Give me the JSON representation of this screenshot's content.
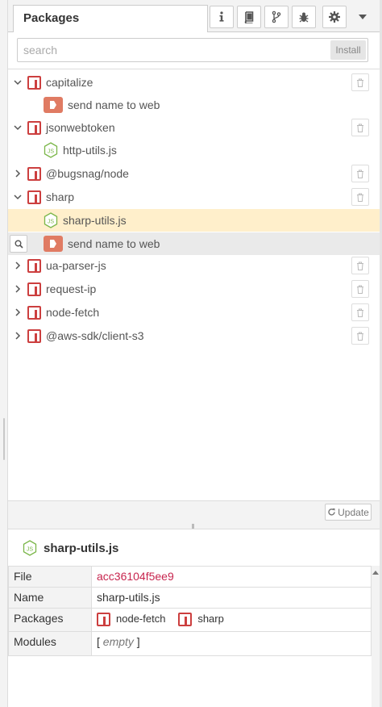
{
  "header": {
    "tab_label": "Packages",
    "buttons": [
      {
        "icon": "info-icon"
      },
      {
        "icon": "book-icon"
      },
      {
        "icon": "branch-icon"
      },
      {
        "icon": "bug-icon"
      },
      {
        "icon": "gear-icon"
      }
    ],
    "dropdown_icon": "caret-down-icon"
  },
  "search": {
    "placeholder": "search",
    "value": "",
    "install_label": "Install"
  },
  "tree": {
    "packages": [
      {
        "name": "capitalize",
        "expanded": true,
        "children": [
          {
            "type": "node",
            "name": "send name to web"
          }
        ]
      },
      {
        "name": "jsonwebtoken",
        "expanded": true,
        "children": [
          {
            "type": "js",
            "name": "http-utils.js"
          }
        ]
      },
      {
        "name": "@bugsnag/node",
        "expanded": false,
        "children": []
      },
      {
        "name": "sharp",
        "expanded": true,
        "children": [
          {
            "type": "js",
            "name": "sharp-utils.js",
            "selected": true
          },
          {
            "type": "node",
            "name": "send name to web",
            "hover": true
          }
        ]
      },
      {
        "name": "ua-parser-js",
        "expanded": false,
        "children": []
      },
      {
        "name": "request-ip",
        "expanded": false,
        "children": []
      },
      {
        "name": "node-fetch",
        "expanded": false,
        "children": []
      },
      {
        "name": "@aws-sdk/client-s3",
        "expanded": false,
        "children": []
      }
    ]
  },
  "update_label": "Update",
  "info": {
    "title": "sharp-utils.js",
    "rows": {
      "file_key": "File",
      "file_value": "acc36104f5ee9",
      "name_key": "Name",
      "name_value": "sharp-utils.js",
      "packages_key": "Packages",
      "packages_values": [
        "node-fetch",
        "sharp"
      ],
      "modules_key": "Modules",
      "modules_open": "[",
      "modules_value": "empty",
      "modules_close": "]"
    }
  },
  "colors": {
    "package_red": "#cc3f3f",
    "node_orange": "#e07b63",
    "js_green": "#7ab648",
    "selected_bg": "#ffefcb",
    "link_red": "#c7254e"
  }
}
